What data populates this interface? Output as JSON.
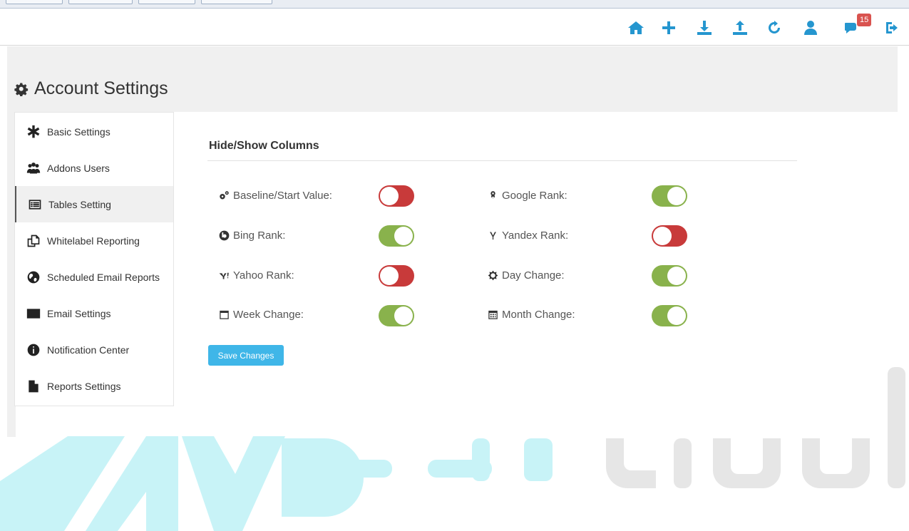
{
  "colors": {
    "nav_accent": "#2596cf",
    "toggle_on": "#89b24c",
    "toggle_off": "#c83a3a",
    "button": "#3fb6e8",
    "badge": "#d9534f"
  },
  "topbar": {
    "icons": [
      "home-icon",
      "plus-icon",
      "download-icon",
      "upload-icon",
      "refresh-icon",
      "user-icon",
      "comments-icon",
      "logout-icon"
    ],
    "notification_count": "15"
  },
  "page": {
    "title": "Account Settings"
  },
  "sidebar": {
    "items": [
      {
        "label": "Basic Settings",
        "icon": "asterisk-icon"
      },
      {
        "label": "Addons Users",
        "icon": "users-icon"
      },
      {
        "label": "Tables Setting",
        "icon": "table-icon",
        "active": true
      },
      {
        "label": "Whitelabel Reporting",
        "icon": "copy-icon"
      },
      {
        "label": "Scheduled Email Reports",
        "icon": "globe-icon"
      },
      {
        "label": "Email Settings",
        "icon": "envelope-icon"
      },
      {
        "label": "Notification Center",
        "icon": "info-icon"
      },
      {
        "label": "Reports Settings",
        "icon": "file-icon"
      }
    ]
  },
  "main": {
    "section_title": "Hide/Show Columns",
    "columns": [
      {
        "label": "Baseline/Start Value:",
        "icon": "cogs-icon",
        "enabled": false
      },
      {
        "label": "Google Rank:",
        "icon": "google-icon",
        "enabled": true
      },
      {
        "label": "Bing Rank:",
        "icon": "bing-icon",
        "enabled": true
      },
      {
        "label": "Yandex Rank:",
        "icon": "yandex-icon",
        "enabled": false
      },
      {
        "label": "Yahoo Rank:",
        "icon": "yahoo-icon",
        "enabled": false
      },
      {
        "label": "Day Change:",
        "icon": "sun-icon",
        "enabled": true
      },
      {
        "label": "Week Change:",
        "icon": "calendar-icon",
        "enabled": true
      },
      {
        "label": "Month Change:",
        "icon": "calendar-grid-icon",
        "enabled": true
      }
    ],
    "save_label": "Save Changes"
  }
}
